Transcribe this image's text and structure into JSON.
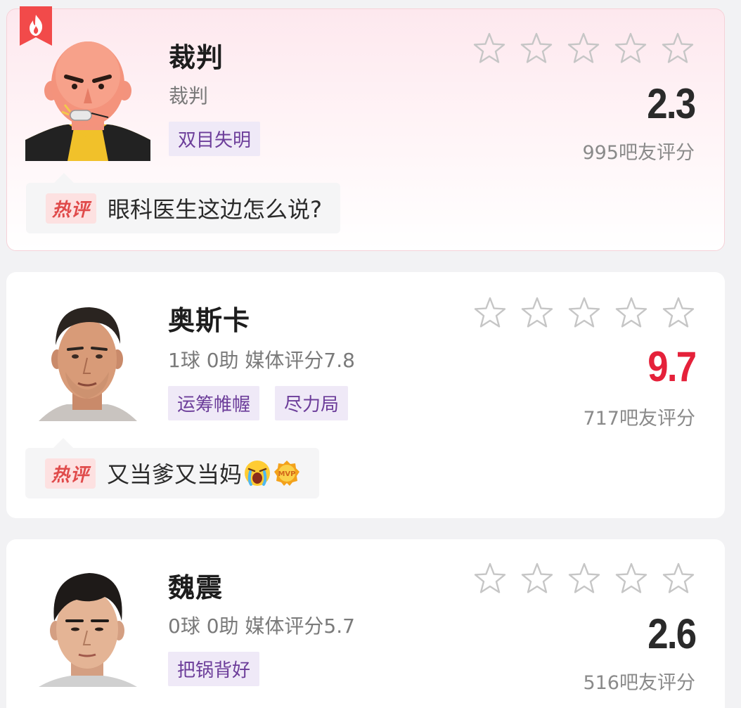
{
  "players": [
    {
      "name": "裁判",
      "subtitle": "裁判",
      "tags": [
        "双目失明"
      ],
      "score": "2.3",
      "rating_count": "995吧友评分",
      "hot_label": "热评",
      "comment": "眼科医生这边怎么说?",
      "stars_filled": 0,
      "is_hot": true
    },
    {
      "name": "奥斯卡",
      "subtitle": "1球  0助   媒体评分7.8",
      "tags": [
        "运筹帷幄",
        "尽力局"
      ],
      "score": "9.7",
      "rating_count": "717吧友评分",
      "hot_label": "热评",
      "comment": "又当爹又当妈",
      "comment_emojis": [
        "crying-face",
        "mvp-badge"
      ],
      "stars_filled": 0,
      "score_color": "#e5213a"
    },
    {
      "name": "魏震",
      "subtitle": "0球  0助   媒体评分5.7",
      "tags": [
        "把锅背好"
      ],
      "score": "2.6",
      "rating_count": "516吧友评分",
      "stars_filled": 0
    }
  ],
  "icons": {
    "hot_badge": "flame-icon",
    "star": "star-outline-icon"
  },
  "colors": {
    "accent_red": "#e5213a",
    "tag_bg": "#efe9f7",
    "tag_text": "#6c3d9a",
    "hot_label_text": "#e04a4a"
  }
}
